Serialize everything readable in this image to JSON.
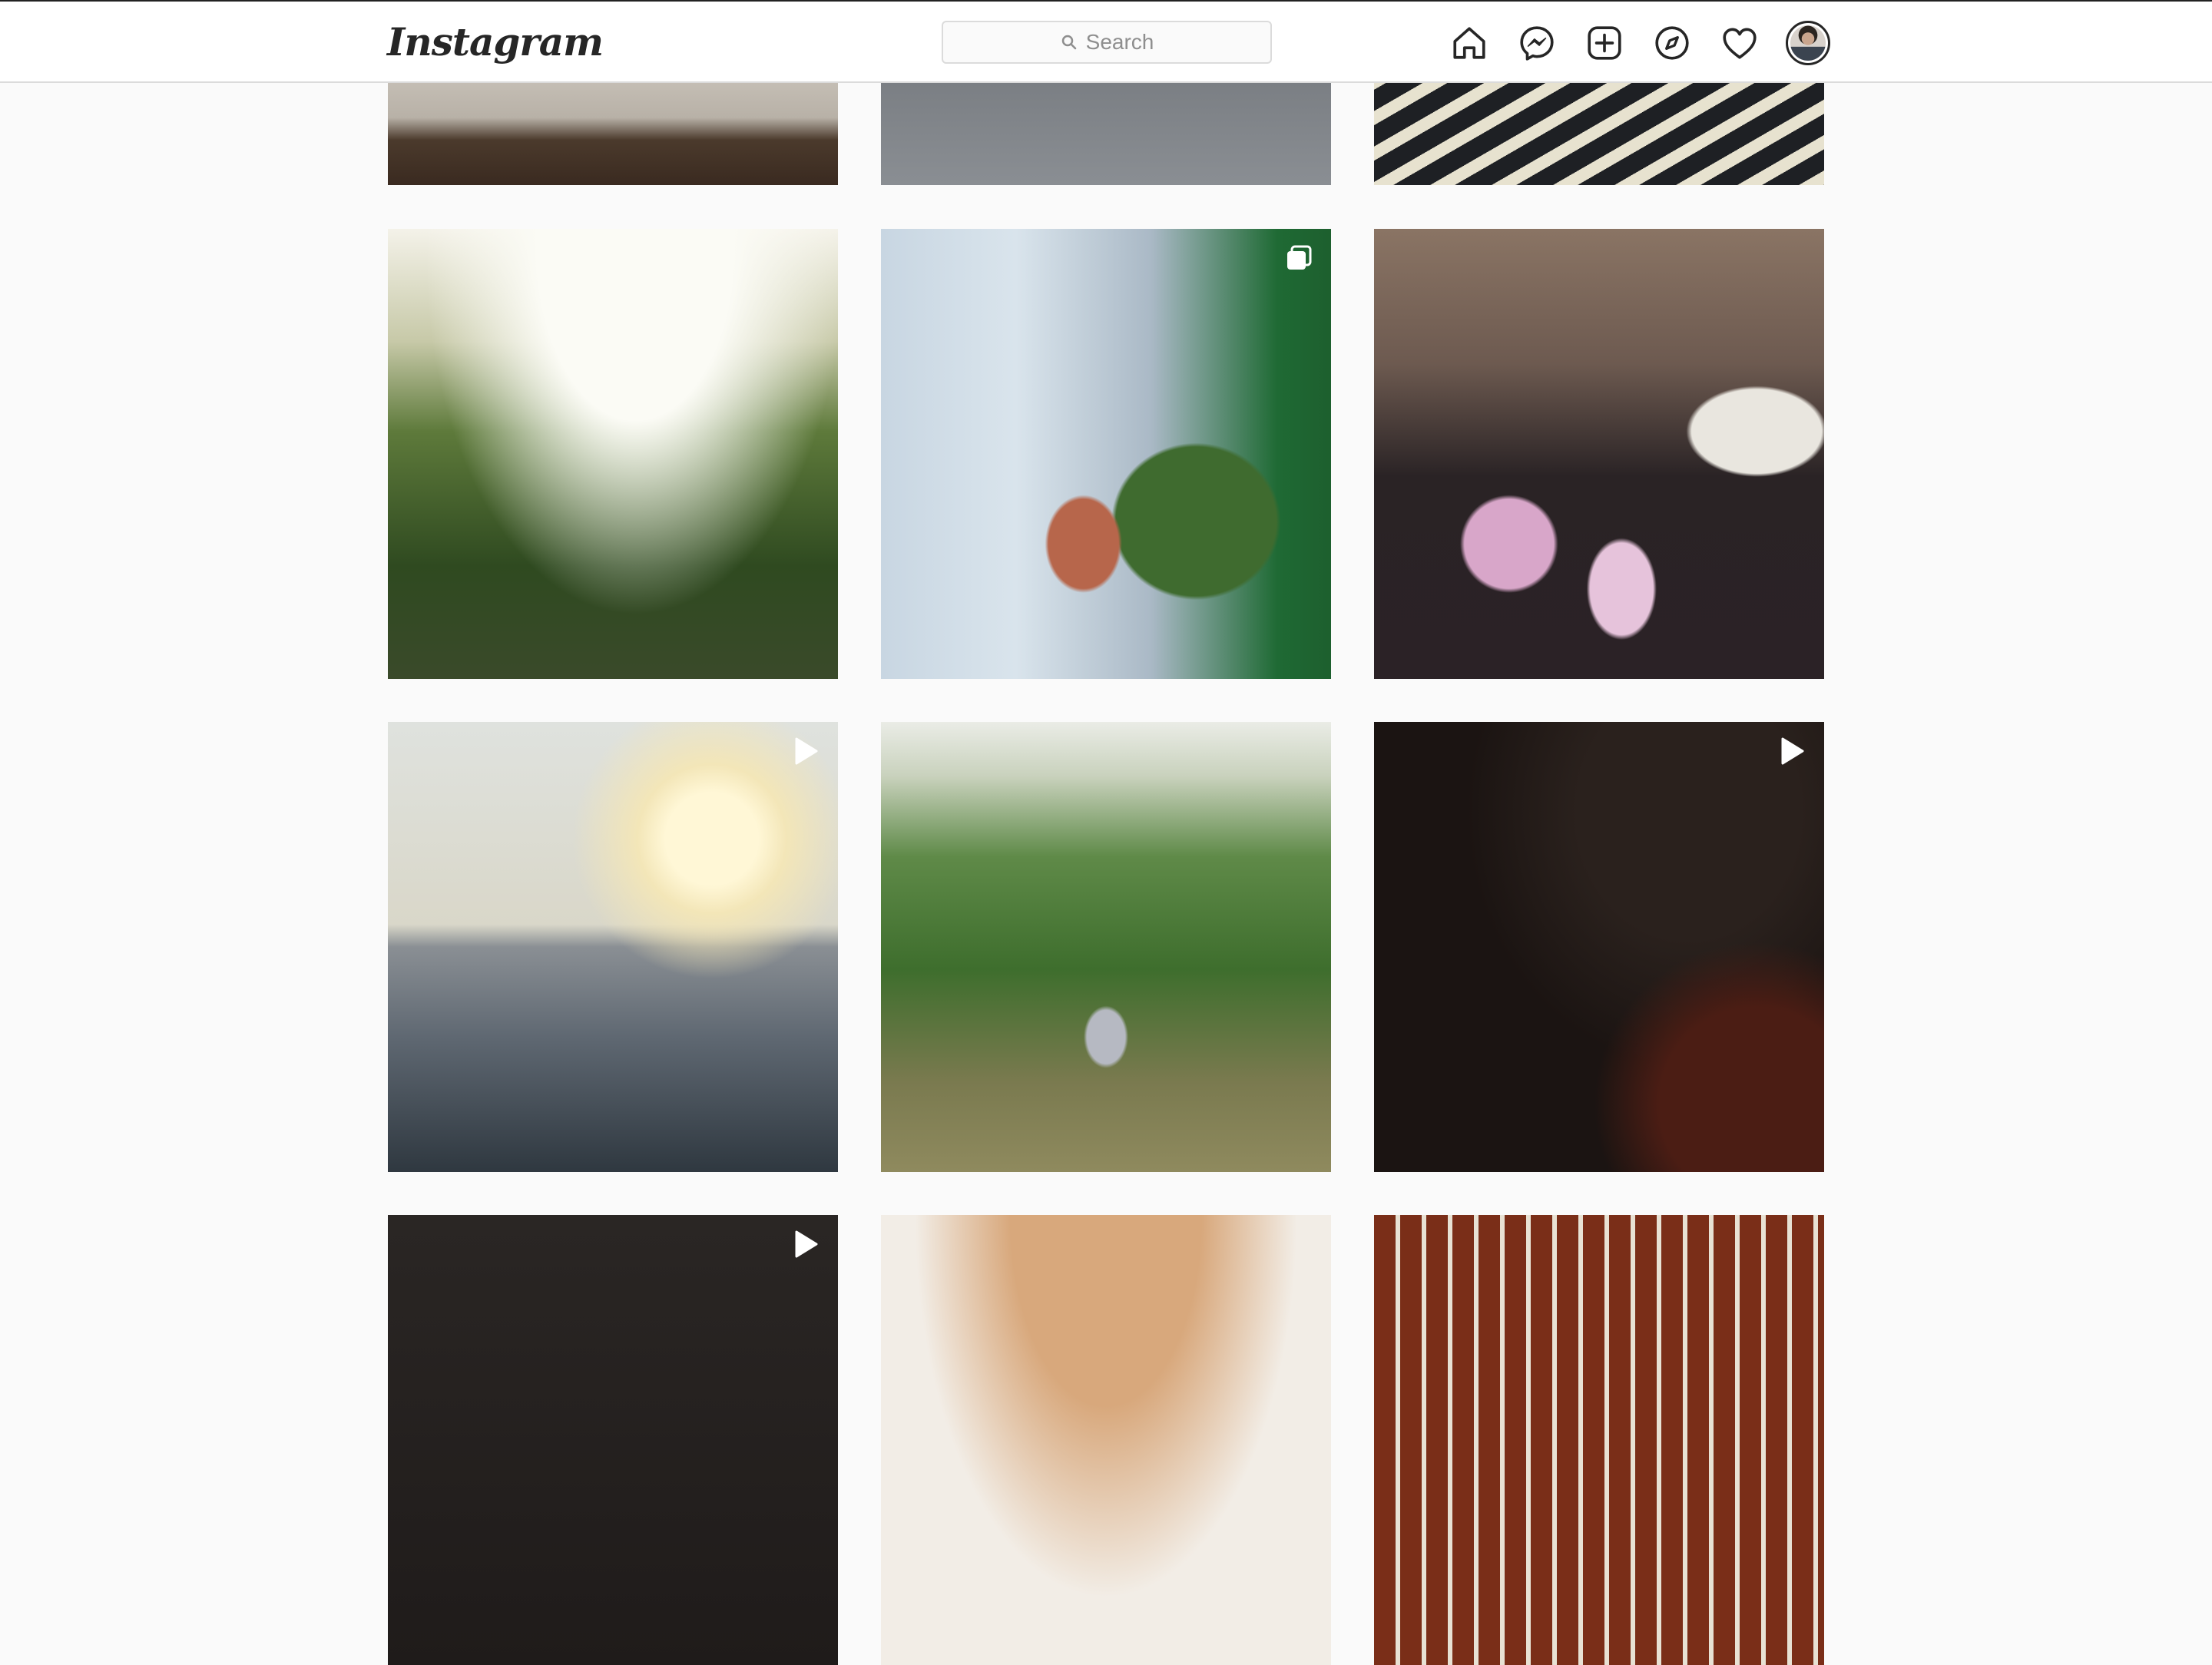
{
  "header": {
    "logo_text": "Instagram",
    "search": {
      "placeholder": "Search",
      "icon": "search-icon"
    },
    "nav": [
      {
        "name": "home-icon"
      },
      {
        "name": "messenger-icon"
      },
      {
        "name": "new-post-icon"
      },
      {
        "name": "explore-compass-icon"
      },
      {
        "name": "activity-heart-icon"
      }
    ],
    "profile": {
      "icon": "avatar"
    }
  },
  "grid": {
    "columns": 3,
    "rows": [
      {
        "tiles": [
          {
            "photo": "document-paper",
            "badge": null
          },
          {
            "photo": "appliance-closeup",
            "badge": null
          },
          {
            "photo": "smiling-face",
            "badge": null
          }
        ]
      },
      {
        "tiles": [
          {
            "photo": "tall-grass-sunlight",
            "badge": null
          },
          {
            "photo": "clownfish-in-bottle",
            "badge": "carousel-icon"
          },
          {
            "photo": "man-with-painted-car",
            "badge": null
          }
        ]
      },
      {
        "tiles": [
          {
            "photo": "sunset-over-sea",
            "badge": "video-play-icon"
          },
          {
            "photo": "man-sitting-by-tree",
            "badge": null
          },
          {
            "photo": "dark-closeup",
            "badge": "video-play-icon"
          }
        ]
      },
      {
        "tiles": [
          {
            "photo": "dark-scene",
            "badge": "video-play-icon"
          },
          {
            "photo": "food-closeup",
            "badge": null
          },
          {
            "photo": "wall-frames",
            "badge": null
          }
        ]
      }
    ]
  }
}
